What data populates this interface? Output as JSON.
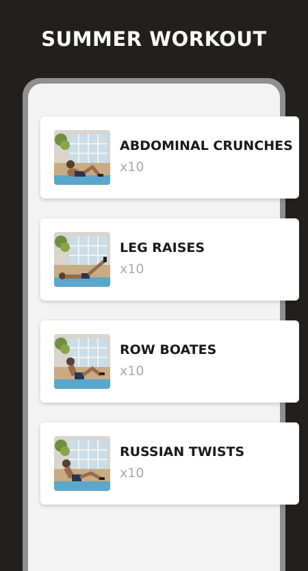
{
  "header": {
    "title": "SUMMER WORKOUT"
  },
  "exercises": [
    {
      "name": "ABDOMINAL CRUNCHES",
      "reps": "x10",
      "thumbnail": "abdominal-crunches-illustration"
    },
    {
      "name": "LEG RAISES",
      "reps": "x10",
      "thumbnail": "leg-raises-illustration"
    },
    {
      "name": "ROW BOATES",
      "reps": "x10",
      "thumbnail": "row-boats-illustration"
    },
    {
      "name": "RUSSIAN TWISTS",
      "reps": "x10",
      "thumbnail": "russian-twists-illustration"
    }
  ],
  "colors": {
    "background": "#231f1e",
    "frame": "#8f8f8f",
    "screen": "#f3f3f3",
    "card": "#ffffff",
    "title_text": "#ffffff",
    "name_text": "#1a1a1a",
    "reps_text": "#a9a9a9"
  }
}
